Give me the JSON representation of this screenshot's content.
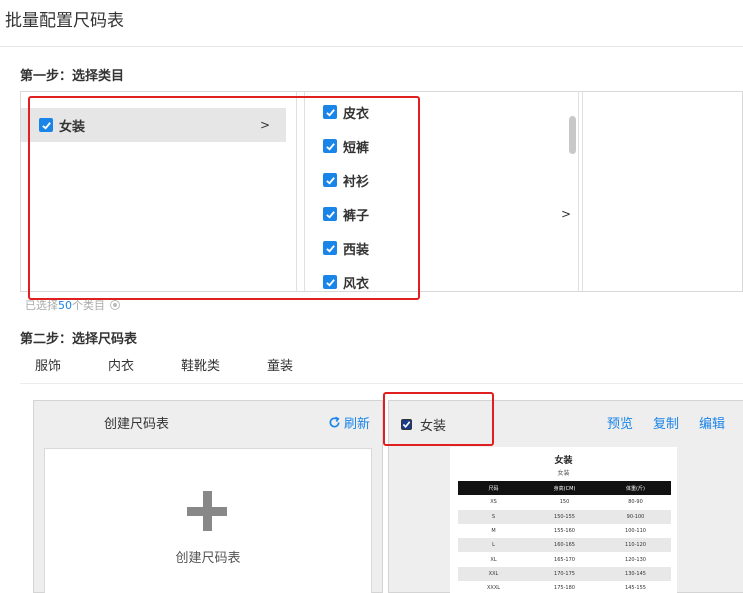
{
  "page": {
    "title": "批量配置尺码表"
  },
  "step1": {
    "label": "第一步：选择类目"
  },
  "categories": {
    "level1": [
      {
        "label": "女装",
        "arrow": ">"
      }
    ],
    "level2": [
      {
        "label": "皮衣"
      },
      {
        "label": "短裤"
      },
      {
        "label": "衬衫"
      },
      {
        "label": "裤子",
        "arrow": ">"
      },
      {
        "label": "西装"
      },
      {
        "label": "风衣"
      }
    ]
  },
  "selection": {
    "prefix": "已选择",
    "count": "50",
    "suffix": "个类目"
  },
  "step2": {
    "label": "第二步：选择尺码表"
  },
  "tabs": [
    "服饰",
    "内衣",
    "鞋靴类",
    "童装"
  ],
  "left_panel": {
    "title": "创建尺码表",
    "refresh": "刷新",
    "create_label": "创建尺码表"
  },
  "right_panel": {
    "checkbox_label": "女装",
    "actions": {
      "preview": "预览",
      "copy": "复制",
      "edit": "编辑"
    },
    "size_table": {
      "title": "女装",
      "subtitle": "女装",
      "headers": [
        "尺码",
        "身高(CM)",
        "体重(斤)"
      ],
      "rows": [
        [
          "XS",
          "150",
          "80-90"
        ],
        [
          "S",
          "150-155",
          "90-100"
        ],
        [
          "M",
          "155-160",
          "100-110"
        ],
        [
          "L",
          "160-165",
          "110-120"
        ],
        [
          "XL",
          "165-170",
          "120-130"
        ],
        [
          "XXL",
          "170-175",
          "130-145"
        ],
        [
          "XXXL",
          "175-180",
          "145-155"
        ]
      ]
    }
  },
  "colors": {
    "accent": "#1a85e8",
    "highlight": "#e02020"
  }
}
